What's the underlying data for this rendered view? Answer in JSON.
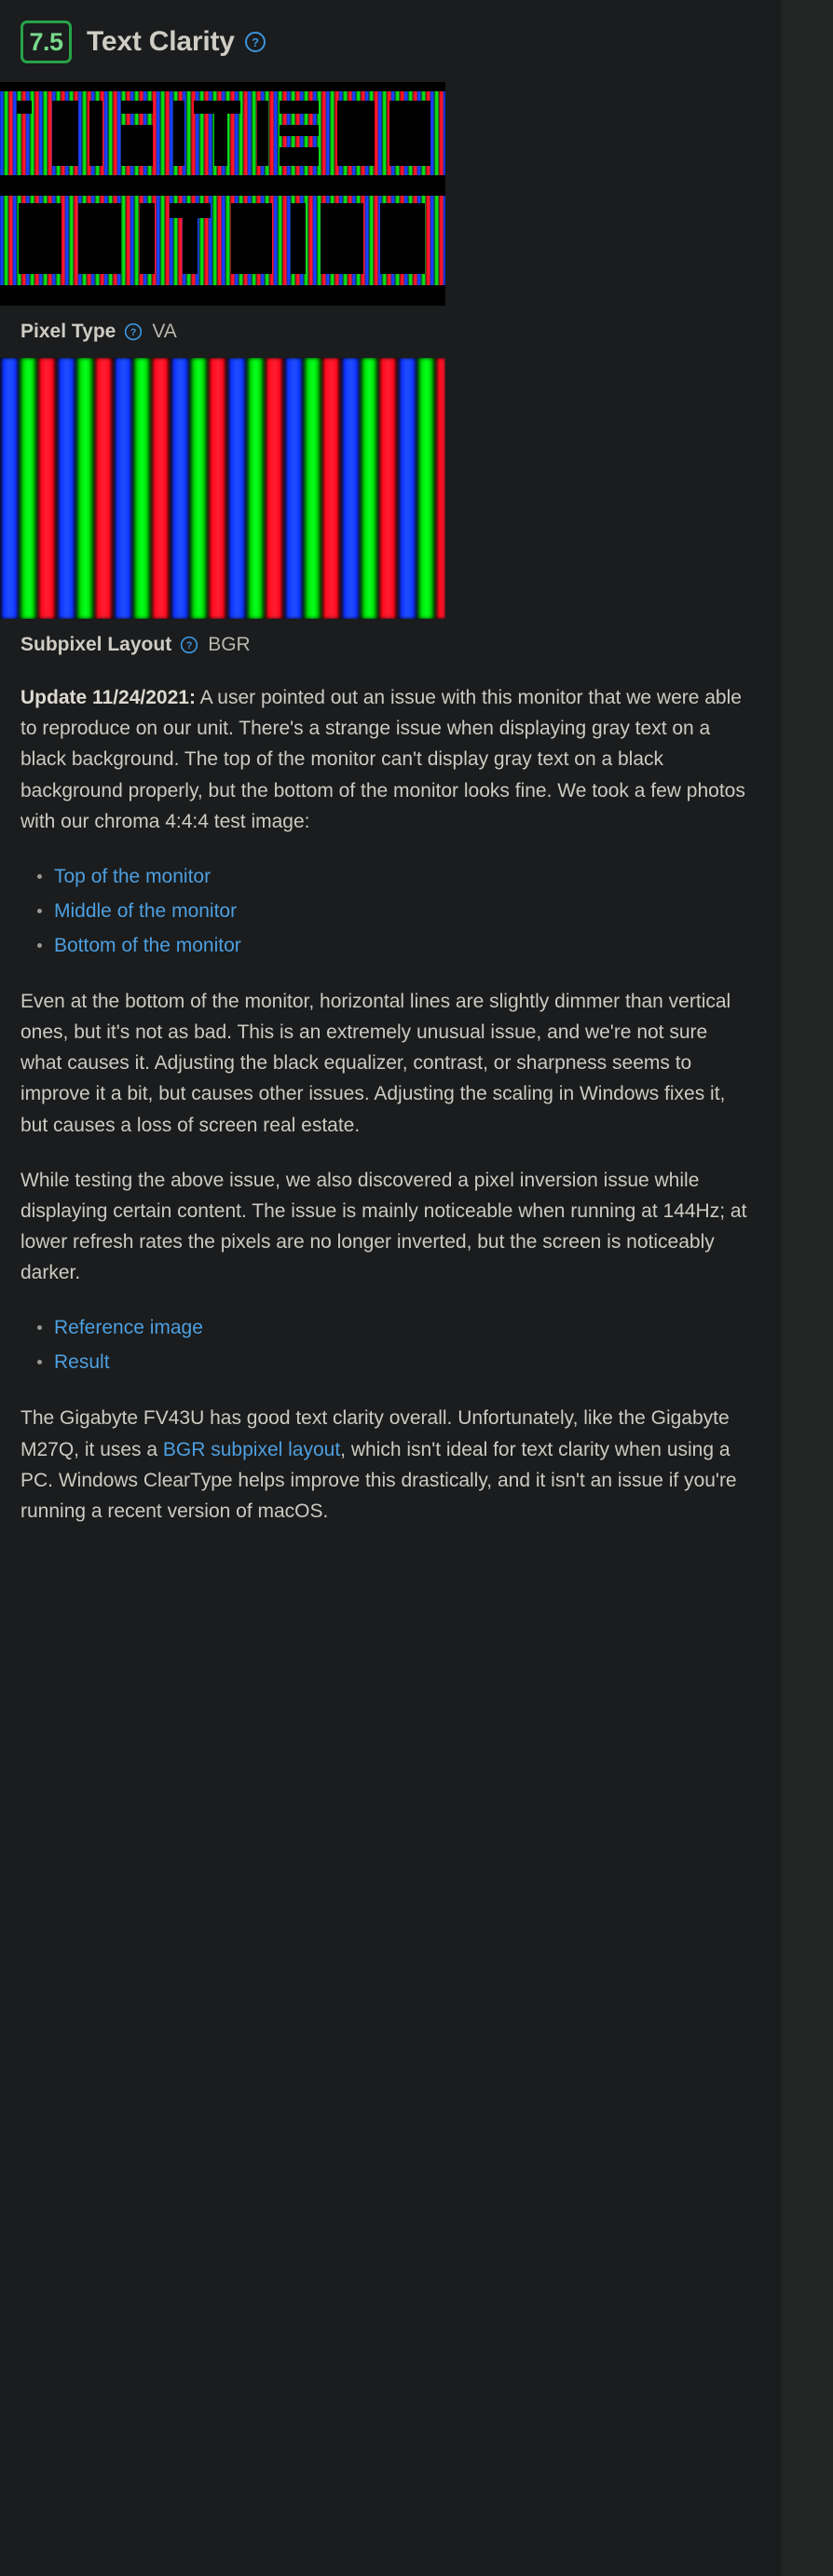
{
  "header": {
    "score": "7.5",
    "title": "Text Clarity",
    "help_icon": "help-circle-icon",
    "score_border_color": "#27a348",
    "score_text_color": "#79d98d"
  },
  "photos": {
    "text_clarity_photo_alt": "text-clarity-macro-photo",
    "subpixel_photo_alt": "subpixel-layout-macro-photo"
  },
  "specs": [
    {
      "label": "Pixel Type",
      "value": "VA",
      "help_icon": "help-circle-icon"
    },
    {
      "label": "Subpixel Layout",
      "value": "BGR",
      "help_icon": "help-circle-icon"
    }
  ],
  "content": {
    "update_label": "Update 11/24/2021:",
    "update_text": " A user pointed out an issue with this monitor that we were able to reproduce on our unit. There's a strange issue when displaying gray text on a black background. The top of the monitor can't display gray text on a black background properly, but the bottom of the monitor looks fine. We took a few photos with our chroma 4:4:4 test image:",
    "photo_links": [
      "Top of the monitor",
      "Middle of the monitor",
      "Bottom of the monitor"
    ],
    "paragraph_2": "Even at the bottom of the monitor, horizontal lines are slightly dimmer than vertical ones, but it's not as bad. This is an extremely unusual issue, and we're not sure what causes it. Adjusting the black equalizer, contrast, or sharpness seems to improve it a bit, but causes other issues. Adjusting the scaling in Windows fixes it, but causes a loss of screen real estate.",
    "paragraph_3": "While testing the above issue, we also discovered a pixel inversion issue while displaying certain content. The issue is mainly noticeable when running at 144Hz; at lower refresh rates the pixels are no longer inverted, but the screen is noticeably darker.",
    "inversion_links": [
      "Reference image",
      "Result"
    ],
    "summary_part_1": "The Gigabyte FV43U has good text clarity overall. Unfortunately, like the Gigabyte M27Q, it uses a ",
    "summary_link": "BGR subpixel layout",
    "summary_part_2": ", which isn't ideal for text clarity when using a PC. Windows ClearType helps improve this drastically, and it isn't an issue if you're running a recent version of macOS."
  },
  "colors": {
    "page_background": "#232524",
    "panel_background": "#1a1c1d",
    "body_text": "#cdcac2",
    "link": "#4d9fe0",
    "score_green": "#27a348",
    "help_blue": "#3b94dd"
  }
}
